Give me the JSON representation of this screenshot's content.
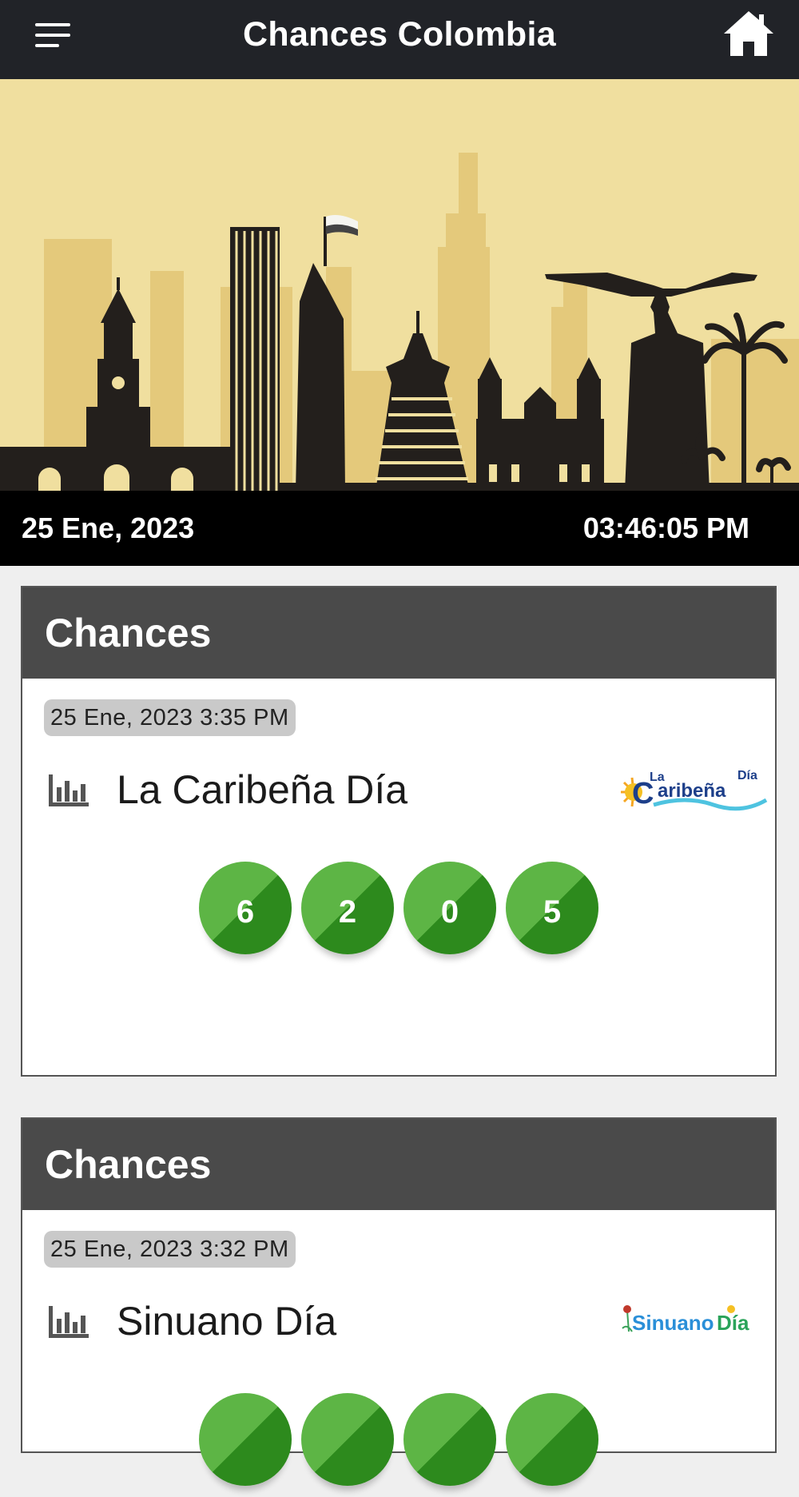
{
  "header": {
    "title": "Chances Colombia",
    "menu_icon": "hamburger-menu-icon",
    "home_icon": "home-icon"
  },
  "hero": {
    "date": "25 Ene, 2023",
    "time": "03:46:05 PM"
  },
  "colors": {
    "topbar": "#212328",
    "card_header": "#4a4a4a",
    "ball_light": "#5db545",
    "ball_dark": "#2d8a1d",
    "hero_sky": "#f0df9f"
  },
  "results": [
    {
      "section_title": "Chances",
      "timestamp": "25 Ene, 2023 3:35 PM",
      "lottery": "La Caribeña Día",
      "logo": {
        "word1": "La",
        "word2": "aribeña",
        "initial": "C",
        "tag": "Día"
      },
      "numbers": [
        "6",
        "2",
        "0",
        "5"
      ]
    },
    {
      "section_title": "Chances",
      "timestamp": "25 Ene, 2023 3:32 PM",
      "lottery": "Sinuano Día",
      "logo": {
        "word1": "Sinuano",
        "word2": "Día"
      },
      "numbers": [
        "",
        "",
        "",
        ""
      ]
    }
  ]
}
